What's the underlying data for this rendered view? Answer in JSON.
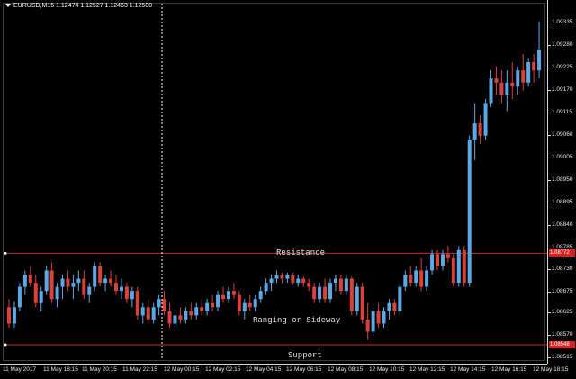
{
  "header": {
    "symbol_info": "EURUSD,M15  1.12474 1.12527 1.12463 1.12500"
  },
  "colors": {
    "background": "#000000",
    "bull": "#5aa9e6",
    "bear": "#d9413a",
    "level_line": "#c0302a",
    "vline": "#ffffff"
  },
  "annotations": {
    "resistance": "Resistance",
    "support": "Support",
    "ranging": "Ranging   or Sideway"
  },
  "price_axis": {
    "ticks": [
      "1.09335",
      "1.09280",
      "1.09225",
      "1.09170",
      "1.09115",
      "1.09060",
      "1.09005",
      "1.08950",
      "1.08895",
      "1.08840",
      "1.08785",
      "1.08730",
      "1.08675",
      "1.08625",
      "1.08570",
      "1.08515"
    ],
    "resistance_label": "1.08772",
    "support_label": "1.08548"
  },
  "time_axis": {
    "ticks": [
      "11 May 2017",
      "11 May 18:15",
      "11 May 20:15",
      "11 May 22:15",
      "12 May 00:15",
      "12 May 02:15",
      "12 May 04:15",
      "12 May 06:15",
      "12 May 08:15",
      "12 May 10:15",
      "12 May 12:15",
      "12 May 14:15",
      "12 May 16:15",
      "12 May 18:15"
    ]
  },
  "chart_data": {
    "type": "candlestick",
    "symbol": "EURUSD",
    "timeframe": "M15",
    "resistance": 1.08772,
    "support": 1.08548,
    "candles": [
      [
        1.0864,
        1.0866,
        1.0859,
        1.086
      ],
      [
        1.086,
        1.08655,
        1.0859,
        1.0864
      ],
      [
        1.0864,
        1.087,
        1.0863,
        1.0869
      ],
      [
        1.0869,
        1.0873,
        1.0867,
        1.0872
      ],
      [
        1.0872,
        1.0874,
        1.0869,
        1.087
      ],
      [
        1.087,
        1.0872,
        1.0864,
        1.0865
      ],
      [
        1.0865,
        1.0869,
        1.0863,
        1.0868
      ],
      [
        1.0868,
        1.0874,
        1.0867,
        1.0873
      ],
      [
        1.0873,
        1.0875,
        1.0865,
        1.0866
      ],
      [
        1.0866,
        1.087,
        1.0864,
        1.0869
      ],
      [
        1.0869,
        1.0872,
        1.0866,
        1.0871
      ],
      [
        1.0871,
        1.0873,
        1.0868,
        1.0869
      ],
      [
        1.0869,
        1.0872,
        1.0866,
        1.087
      ],
      [
        1.087,
        1.0873,
        1.0868,
        1.0871
      ],
      [
        1.0871,
        1.0873,
        1.0866,
        1.0867
      ],
      [
        1.0867,
        1.087,
        1.0865,
        1.0869
      ],
      [
        1.0869,
        1.0875,
        1.0868,
        1.0874
      ],
      [
        1.0874,
        1.0875,
        1.0869,
        1.087
      ],
      [
        1.087,
        1.0872,
        1.0868,
        1.0871
      ],
      [
        1.0871,
        1.0873,
        1.0869,
        1.087
      ],
      [
        1.087,
        1.0872,
        1.0867,
        1.0868
      ],
      [
        1.0868,
        1.0871,
        1.0866,
        1.0869
      ],
      [
        1.0869,
        1.087,
        1.0865,
        1.0866
      ],
      [
        1.0866,
        1.0869,
        1.0864,
        1.0868
      ],
      [
        1.0868,
        1.0869,
        1.0861,
        1.0862
      ],
      [
        1.0862,
        1.0865,
        1.086,
        1.0864
      ],
      [
        1.0864,
        1.0866,
        1.086,
        1.0861
      ],
      [
        1.0861,
        1.0865,
        1.086,
        1.0864
      ],
      [
        1.0864,
        1.0867,
        1.0862,
        1.0866
      ],
      [
        1.0866,
        1.0868,
        1.0862,
        1.0863
      ],
      [
        1.0863,
        1.0865,
        1.0859,
        1.086
      ],
      [
        1.086,
        1.0863,
        1.0859,
        1.0862
      ],
      [
        1.0862,
        1.0864,
        1.086,
        1.0861
      ],
      [
        1.0861,
        1.0864,
        1.086,
        1.0863
      ],
      [
        1.0863,
        1.0865,
        1.0861,
        1.0862
      ],
      [
        1.0862,
        1.0865,
        1.0861,
        1.0864
      ],
      [
        1.0864,
        1.0866,
        1.0862,
        1.0863
      ],
      [
        1.0863,
        1.0866,
        1.0862,
        1.0865
      ],
      [
        1.0865,
        1.0867,
        1.0863,
        1.0864
      ],
      [
        1.0864,
        1.0868,
        1.0863,
        1.0867
      ],
      [
        1.0867,
        1.0869,
        1.0865,
        1.0866
      ],
      [
        1.0866,
        1.0869,
        1.0865,
        1.0868
      ],
      [
        1.0868,
        1.087,
        1.0866,
        1.0867
      ],
      [
        1.0867,
        1.0868,
        1.0862,
        1.0863
      ],
      [
        1.0863,
        1.0866,
        1.0861,
        1.0865
      ],
      [
        1.0865,
        1.0867,
        1.0863,
        1.0864
      ],
      [
        1.0864,
        1.0867,
        1.0863,
        1.0866
      ],
      [
        1.0866,
        1.0869,
        1.0865,
        1.0868
      ],
      [
        1.0868,
        1.0871,
        1.0867,
        1.087
      ],
      [
        1.087,
        1.0872,
        1.0868,
        1.0871
      ],
      [
        1.0871,
        1.0873,
        1.087,
        1.0872
      ],
      [
        1.0872,
        1.08725,
        1.087,
        1.0871
      ],
      [
        1.0871,
        1.08725,
        1.087,
        1.0872
      ],
      [
        1.0872,
        1.08725,
        1.08695,
        1.087
      ],
      [
        1.087,
        1.0872,
        1.0869,
        1.0871
      ],
      [
        1.0871,
        1.08715,
        1.0869,
        1.087
      ],
      [
        1.087,
        1.0871,
        1.0868,
        1.0869
      ],
      [
        1.0869,
        1.087,
        1.0865,
        1.0866
      ],
      [
        1.0866,
        1.087,
        1.0865,
        1.0869
      ],
      [
        1.0869,
        1.0871,
        1.0865,
        1.0866
      ],
      [
        1.0866,
        1.0871,
        1.0865,
        1.087
      ],
      [
        1.087,
        1.0872,
        1.0868,
        1.0871
      ],
      [
        1.0871,
        1.0872,
        1.0867,
        1.0868
      ],
      [
        1.0868,
        1.0872,
        1.0867,
        1.0871
      ],
      [
        1.0871,
        1.08715,
        1.0862,
        1.0863
      ],
      [
        1.0863,
        1.087,
        1.0862,
        1.0869
      ],
      [
        1.0869,
        1.087,
        1.086,
        1.0861
      ],
      [
        1.0861,
        1.0865,
        1.0856,
        1.0858
      ],
      [
        1.0858,
        1.0864,
        1.0857,
        1.0863
      ],
      [
        1.0863,
        1.0865,
        1.0859,
        1.086
      ],
      [
        1.086,
        1.0864,
        1.0859,
        1.0863
      ],
      [
        1.0863,
        1.0866,
        1.0861,
        1.0865
      ],
      [
        1.0865,
        1.0866,
        1.0862,
        1.0863
      ],
      [
        1.0863,
        1.087,
        1.0862,
        1.0869
      ],
      [
        1.0869,
        1.0873,
        1.0868,
        1.0872
      ],
      [
        1.0872,
        1.0874,
        1.0869,
        1.087
      ],
      [
        1.087,
        1.0874,
        1.0869,
        1.0873
      ],
      [
        1.0873,
        1.0876,
        1.0868,
        1.0869
      ],
      [
        1.0869,
        1.0874,
        1.0868,
        1.0873
      ],
      [
        1.0873,
        1.0878,
        1.0872,
        1.0877
      ],
      [
        1.0877,
        1.0878,
        1.0873,
        1.0874
      ],
      [
        1.0874,
        1.0878,
        1.0873,
        1.0877
      ],
      [
        1.0877,
        1.0879,
        1.0875,
        1.0876
      ],
      [
        1.0876,
        1.0877,
        1.0869,
        1.087
      ],
      [
        1.087,
        1.0879,
        1.0869,
        1.0878
      ],
      [
        1.0878,
        1.0879,
        1.0869,
        1.087
      ],
      [
        1.087,
        1.0906,
        1.0869,
        1.0905
      ],
      [
        1.0905,
        1.0914,
        1.09,
        1.0909
      ],
      [
        1.0909,
        1.0911,
        1.0904,
        1.0906
      ],
      [
        1.0906,
        1.0915,
        1.0905,
        1.0914
      ],
      [
        1.0914,
        1.0922,
        1.0913,
        1.092
      ],
      [
        1.092,
        1.0923,
        1.0916,
        1.0919
      ],
      [
        1.0919,
        1.0922,
        1.0914,
        1.0916
      ],
      [
        1.0916,
        1.0922,
        1.0912,
        1.0919
      ],
      [
        1.0919,
        1.0924,
        1.0915,
        1.0918
      ],
      [
        1.0918,
        1.0923,
        1.0916,
        1.0922
      ],
      [
        1.0922,
        1.0926,
        1.0917,
        1.0919
      ],
      [
        1.0919,
        1.0925,
        1.0918,
        1.0924
      ],
      [
        1.0924,
        1.0926,
        1.0919,
        1.0922
      ],
      [
        1.0922,
        1.0934,
        1.092,
        1.0927
      ]
    ]
  }
}
